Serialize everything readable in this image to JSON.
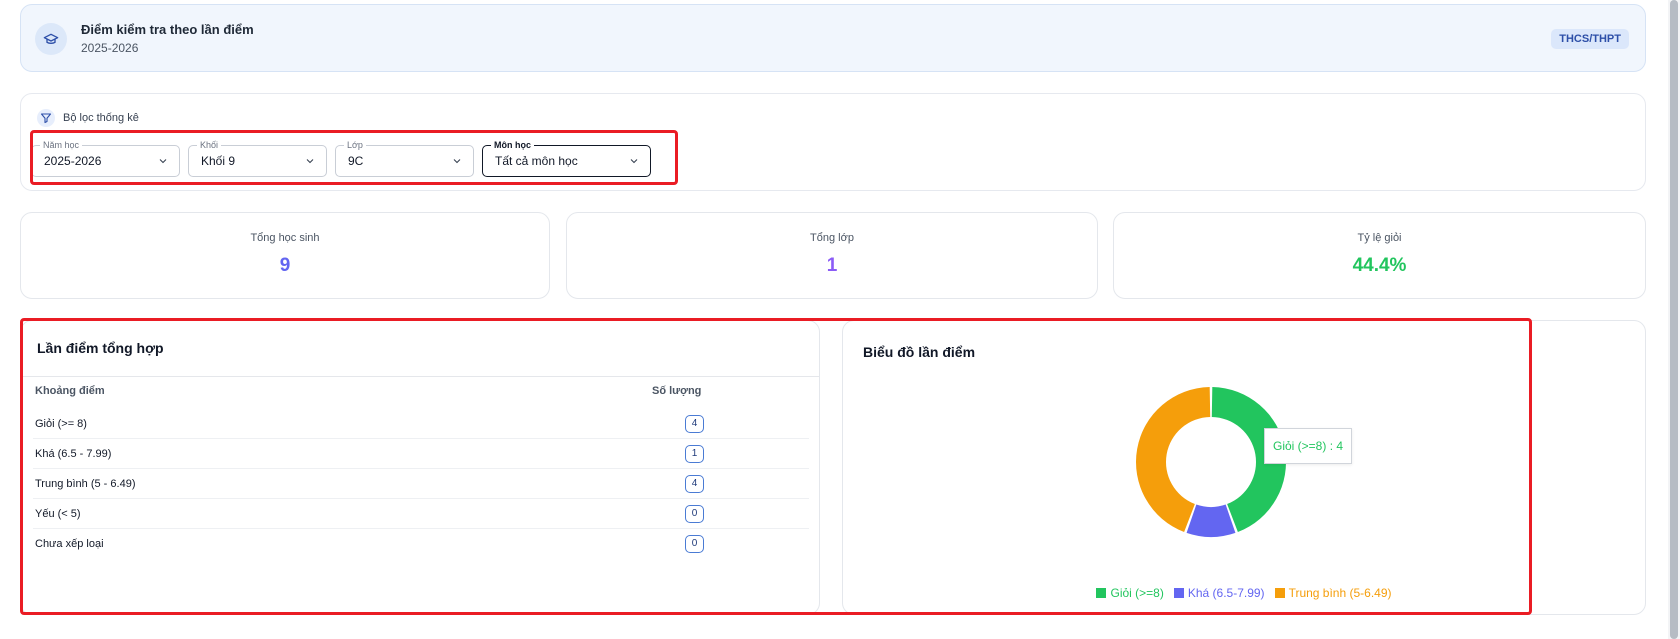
{
  "header": {
    "title": "Điểm kiểm tra theo lần điểm",
    "subtitle": "2025-2026",
    "badge": "THCS/THPT",
    "icon": "graduation-cap-icon"
  },
  "filters": {
    "title": "Bộ lọc thống kê",
    "icon": "filter-icon",
    "school_year": {
      "label": "Năm học",
      "value": "2025-2026"
    },
    "grade": {
      "label": "Khối",
      "value": "Khối 9"
    },
    "class": {
      "label": "Lớp",
      "value": "9C"
    },
    "subject": {
      "label": "Môn học",
      "value": "Tất cả môn học"
    }
  },
  "stats": [
    {
      "label": "Tổng học sinh",
      "value": "9",
      "color": "#6366f1"
    },
    {
      "label": "Tổng lớp",
      "value": "1",
      "color": "#8b5cf6"
    },
    {
      "label": "Tỷ lệ giỏi",
      "value": "44.4%",
      "color": "#22c55e"
    }
  ],
  "summary_table": {
    "title": "Lần điểm tổng hợp",
    "columns": [
      "Khoảng điểm",
      "Số lượng"
    ],
    "rows": [
      {
        "range": "Giỏi (>= 8)",
        "count": "4"
      },
      {
        "range": "Khá (6.5 - 7.99)",
        "count": "1"
      },
      {
        "range": "Trung bình (5 - 6.49)",
        "count": "4"
      },
      {
        "range": "Yếu (< 5)",
        "count": "0"
      },
      {
        "range": "Chưa xếp loại",
        "count": "0"
      }
    ]
  },
  "chart": {
    "title": "Biểu đồ lần điểm",
    "tooltip": "Giỏi (>=8) : 4"
  },
  "chart_data": {
    "type": "pie",
    "categories": [
      "Giỏi (>=8)",
      "Khá (6.5-7.99)",
      "Trung bình (5-6.49)"
    ],
    "values": [
      4,
      1,
      4
    ],
    "colors": [
      "#22c55e",
      "#6366f1",
      "#f59e0b"
    ],
    "donut": true,
    "legend": "bottom",
    "title": ""
  },
  "colors": {
    "accent": "#2d4fa8",
    "highlight": "#ea1c24"
  }
}
